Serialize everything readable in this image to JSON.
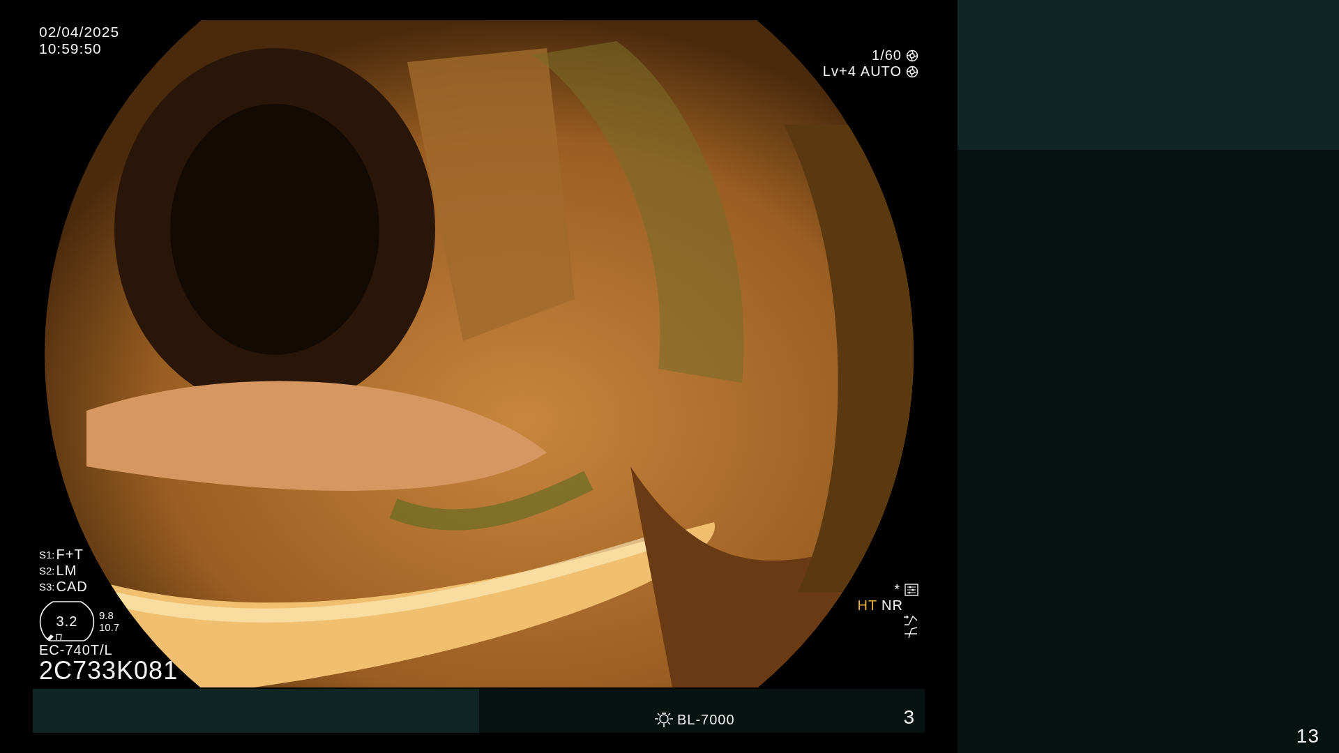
{
  "datetime": {
    "date": "02/04/2025",
    "time": "10:59:50"
  },
  "exposure": {
    "shutter": "1/60",
    "level": "Lv+4",
    "iris": "AUTO"
  },
  "scope_settings": [
    {
      "key": "S1:",
      "value": "F+T"
    },
    {
      "key": "S2:",
      "value": "LM"
    },
    {
      "key": "S3:",
      "value": "CAD"
    }
  ],
  "gauge": {
    "value": "3.2",
    "readings": [
      "9.8",
      "10.7"
    ]
  },
  "scope": {
    "model": "EC-740T/L",
    "serial": "2C733K081"
  },
  "status": {
    "marker": "*",
    "modes": [
      {
        "label": "HT",
        "on": true
      },
      {
        "label": "NR",
        "on": false
      }
    ]
  },
  "bottom_bar": {
    "light_source": "BL-7000",
    "channel": "3"
  },
  "side_panel": {
    "page": "13"
  }
}
